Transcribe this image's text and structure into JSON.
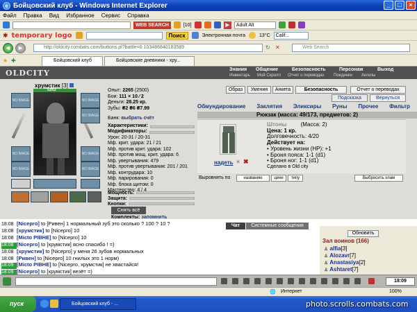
{
  "window": {
    "title": "Бойцовский клуб - Windows Internet Explorer"
  },
  "menubar": {
    "items": [
      "Файл",
      "Правка",
      "Вид",
      "Избранное",
      "Сервис",
      "Справка"
    ]
  },
  "toolbar1": {
    "websearch_label": "WEB SEARCH",
    "mail_count": "[10]",
    "adult_filter": "Adult Alt",
    "games_label": "Games",
    "feed_label": "RSS"
  },
  "toolbar2": {
    "logo": "temporary logo",
    "search_button": "Поиск",
    "email_label": "Электронная почта",
    "temperature": "13°C",
    "search_placeholder": "Calif..."
  },
  "addressbar": {
    "url": "http://oldcity.combats.com/buttons.pl?battle=0.103486840183589",
    "search_placeholder": "Web Search"
  },
  "tabs": [
    {
      "label": "Бойцовский клуб"
    },
    {
      "label": "Бойцовские дневники - хру..."
    }
  ],
  "game": {
    "logo": "OLDCITY",
    "menu_top": [
      "Знания",
      "Общение",
      "Безопасность",
      "Персонаж",
      "Выход"
    ],
    "menu_sub": [
      "Инвентарь",
      "Мой Скролл",
      "Отчет о переводах",
      "Поединки",
      "Ангелы"
    ],
    "character": {
      "name": "хрумстик",
      "level": "[3]",
      "hp": "53/53",
      "slot_label": "NO IMAGE",
      "stats": {
        "opyt_label": "Опыт:",
        "opyt_value": "2265",
        "opyt_next": "(2500)",
        "boi_label": "Бои:",
        "boi_value": "111 × 10 ⁄ 2",
        "dengi_label": "Деньги:",
        "dengi_value": "28.25 кр.",
        "zuby_label": "Зубы:",
        "zuby_value": "₴2 ₴6 ₴7.99"
      },
      "bank_label": "Банк:",
      "bank_action": "выбрать счёт",
      "sections": [
        "Характеристики:",
        "Модификаторы:"
      ],
      "modifiers": [
        "Урон: 20-31 / 20-31",
        "Мф. крит. удара: 21 / 21",
        "Мф. против крит. удара: 102",
        "Мф. против мощ. крит. удара: 6",
        "Мф. увертывания: 479",
        "Мф. против увертывания: 201 / 201",
        "Мф. контрудара: 10",
        "Мф. парирования: 0",
        "Мф. блока щитом: 0",
        "Мастерство: 4 / 4"
      ],
      "sections2": [
        "Мощность:",
        "Защита:",
        "Кнопки:"
      ],
      "take_off_all": "Снять всё",
      "komplekty_label": "Комплекты:",
      "komplekty_action": "запомнить"
    },
    "right_buttons": [
      "Образ",
      "Умения",
      "Анкета",
      "Безопасность",
      "Отчет о переводах"
    ],
    "sub_buttons": [
      "Подсказка",
      "Вернуться"
    ],
    "categories": [
      "Обмундирование",
      "Заклятия",
      "Эликсиры",
      "Руны",
      "Прочее",
      "Фильтр"
    ],
    "backpack_title": "Рюкзак (масса: 49/173, предметов: 2)",
    "item": {
      "name": "Штоны",
      "mass": "(Масса: 2)",
      "price": "Цена: 1 кр.",
      "durability": "Долговечность: 4/20",
      "effects_label": "Действует на:",
      "effects": [
        "• Уровень жизни (HP): +1",
        "• Броня пояса: 1-1 (d1)",
        "• Броня ног: 1-1 (d1)"
      ],
      "made_in": "Сделано в Old city",
      "wear_action": "надеть"
    },
    "sort": {
      "label": "Выровнять по",
      "buttons": [
        "названию",
        "цене",
        "типу"
      ],
      "wide_button": "Выбросить хлам"
    }
  },
  "chat": {
    "tabs": [
      "Чат",
      "Системные сообщения"
    ],
    "lines": [
      {
        "time": "18:08",
        "hl": false,
        "nick": "[Nicepro]",
        "text": " to [Ривен] 1 нормальный зуб это сколько ? 100 ? 10 ?"
      },
      {
        "time": "18:08",
        "hl": false,
        "nick": "[хрумстик]",
        "text": " to [Nicepro] 10"
      },
      {
        "time": "18:08",
        "hl": false,
        "nick": "[Micto PIBHE]",
        "text": " to [Nicepro] 10"
      },
      {
        "time": "18:08",
        "hl": true,
        "nick": "[Nicepro]",
        "text": " to [хрумстик] ясно спасибо ! =)"
      },
      {
        "time": "18:08",
        "hl": false,
        "nick": "[хрумстик]",
        "text": " to [Nicepro] у меня 26 зубов нормальных"
      },
      {
        "time": "18:08",
        "hl": false,
        "nick": "[Ривен]",
        "text": " to [Nicepro] 10 гнилых это 1 норм)"
      },
      {
        "time": "18:09",
        "hl": true,
        "nick": "[Micto PIBHE]",
        "text": " to [Nicepro, хрумстик] не хвастайся!"
      },
      {
        "time": "18:09",
        "hl": true,
        "nick": "[Nicepro]",
        "text": " to [хрумстик] везёт =)"
      }
    ],
    "refresh_button": "Обновить",
    "room_title": "Зал воинов (166)",
    "warriors": [
      {
        "name": "alfia",
        "level": "[3]"
      },
      {
        "name": "Alozavr",
        "level": "[7]"
      },
      {
        "name": "Anastasiya",
        "level": "[2]"
      },
      {
        "name": "Ashtaret",
        "level": "[7]"
      }
    ],
    "clock": "18:09"
  },
  "statusbar": {
    "zone": "Интернет",
    "zoom": "100%"
  },
  "taskbar": {
    "start": "пуск",
    "item": "Бойцовский клуб - ...",
    "watermark": "photo.scrolls.combats.com"
  }
}
